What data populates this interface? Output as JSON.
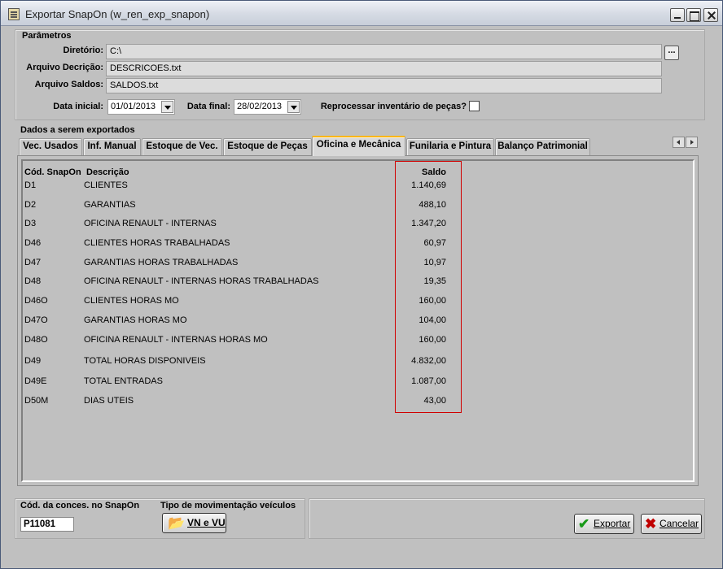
{
  "window": {
    "title": "Exportar SnapOn (w_ren_exp_snapon)"
  },
  "parametros": {
    "label": "Parâmetros",
    "diretorio_label": "Diretório:",
    "diretorio_value": "C:\\",
    "browse_label": "...",
    "arq_descricao_label": "Arquivo Decrição:",
    "arq_descricao_value": "DESCRICOES.txt",
    "arq_saldos_label": "Arquivo Saldos:",
    "arq_saldos_value": "SALDOS.txt",
    "data_inicial_label": "Data inicial:",
    "data_inicial_value": "01/01/2013",
    "data_final_label": "Data final:",
    "data_final_value": "28/02/2013",
    "reprocessar_label": "Reprocessar inventário de peças?",
    "reprocessar_checked": false
  },
  "dados": {
    "label": "Dados a serem exportados",
    "tabs": [
      {
        "label": "Vec. Usados"
      },
      {
        "label": "Inf. Manual"
      },
      {
        "label": "Estoque de Vec."
      },
      {
        "label": "Estoque de Peças"
      },
      {
        "label": "Oficina e Mecânica"
      },
      {
        "label": "Funilaria e Pintura"
      },
      {
        "label": "Balanço Patrimonial"
      }
    ],
    "active_tab": "Oficina e Mecânica",
    "columns": {
      "codigo": "Cód. SnapOn",
      "descricao": "Descrição",
      "saldo": "Saldo"
    },
    "rows": [
      {
        "codigo": "D1",
        "descricao": "CLIENTES",
        "saldo": "1.140,69"
      },
      {
        "codigo": "D2",
        "descricao": "GARANTIAS",
        "saldo": "488,10"
      },
      {
        "codigo": "D3",
        "descricao": "OFICINA RENAULT - INTERNAS",
        "saldo": "1.347,20"
      },
      {
        "codigo": "D46",
        "descricao": "CLIENTES HORAS TRABALHADAS",
        "saldo": "60,97"
      },
      {
        "codigo": "D47",
        "descricao": "GARANTIAS HORAS TRABALHADAS",
        "saldo": "10,97"
      },
      {
        "codigo": "D48",
        "descricao": "OFICINA RENAULT - INTERNAS HORAS TRABALHADAS",
        "saldo": "19,35"
      },
      {
        "codigo": "D46O",
        "descricao": "CLIENTES HORAS MO",
        "saldo": "160,00"
      },
      {
        "codigo": "D47O",
        "descricao": "GARANTIAS HORAS MO",
        "saldo": "104,00"
      },
      {
        "codigo": "D48O",
        "descricao": "OFICINA RENAULT - INTERNAS HORAS MO",
        "saldo": "160,00"
      },
      {
        "codigo": "D49",
        "descricao": "TOTAL HORAS DISPONIVEIS",
        "saldo": "4.832,00"
      },
      {
        "codigo": "D49E",
        "descricao": "TOTAL ENTRADAS",
        "saldo": "1.087,00"
      },
      {
        "codigo": "D50M",
        "descricao": "DIAS UTEIS",
        "saldo": "43,00"
      }
    ]
  },
  "footer": {
    "cod_conces_label": "Cód. da conces. no SnapOn",
    "cod_conces_value": "P11081",
    "tipo_mov_label": "Tipo de movimentação veículos",
    "tipo_mov_button": "VN e VU",
    "exportar_button": "Exportar",
    "cancelar_button": "Cancelar"
  },
  "colors": {
    "highlight_border": "#d00000",
    "active_tab_accent": "#ffb600",
    "window_bg": "#c0c0c0"
  }
}
